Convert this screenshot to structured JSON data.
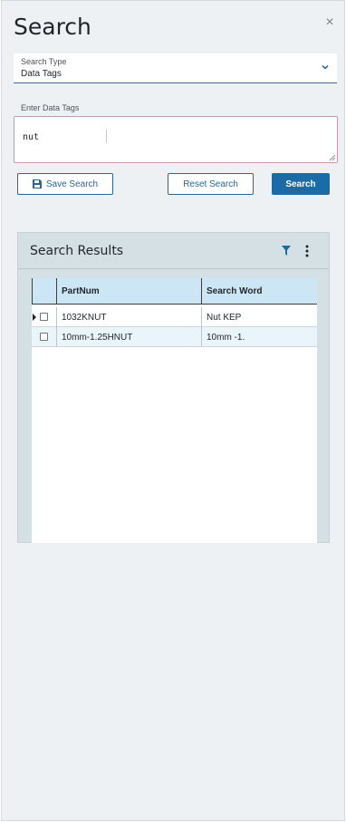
{
  "panel": {
    "title": "Search",
    "close_glyph": "×",
    "close_icon": "close-icon"
  },
  "search_type": {
    "label": "Search Type",
    "value": "Data Tags",
    "icon": "chevron-down-icon"
  },
  "data_tags": {
    "label": "Enter Data Tags",
    "value": "nut"
  },
  "buttons": {
    "save": "Save Search",
    "save_icon": "save-icon",
    "reset": "Reset Search",
    "search": "Search"
  },
  "results": {
    "title": "Search Results",
    "filter_icon": "filter-icon",
    "menu_icon": "more-vertical-icon",
    "columns": [
      "PartNum",
      "Search Word"
    ],
    "rows": [
      {
        "part": "1032KNUT",
        "word": "Nut KEP",
        "selected": false,
        "current": true
      },
      {
        "part": "10mm-1.25HNUT",
        "word": "10mm -1.",
        "selected": false,
        "current": false
      }
    ]
  },
  "colors": {
    "accent": "#1a6ba6",
    "panel_bg": "#edf1f4",
    "grid_header": "#cce6f6",
    "alt_row": "#eaf5fb"
  }
}
